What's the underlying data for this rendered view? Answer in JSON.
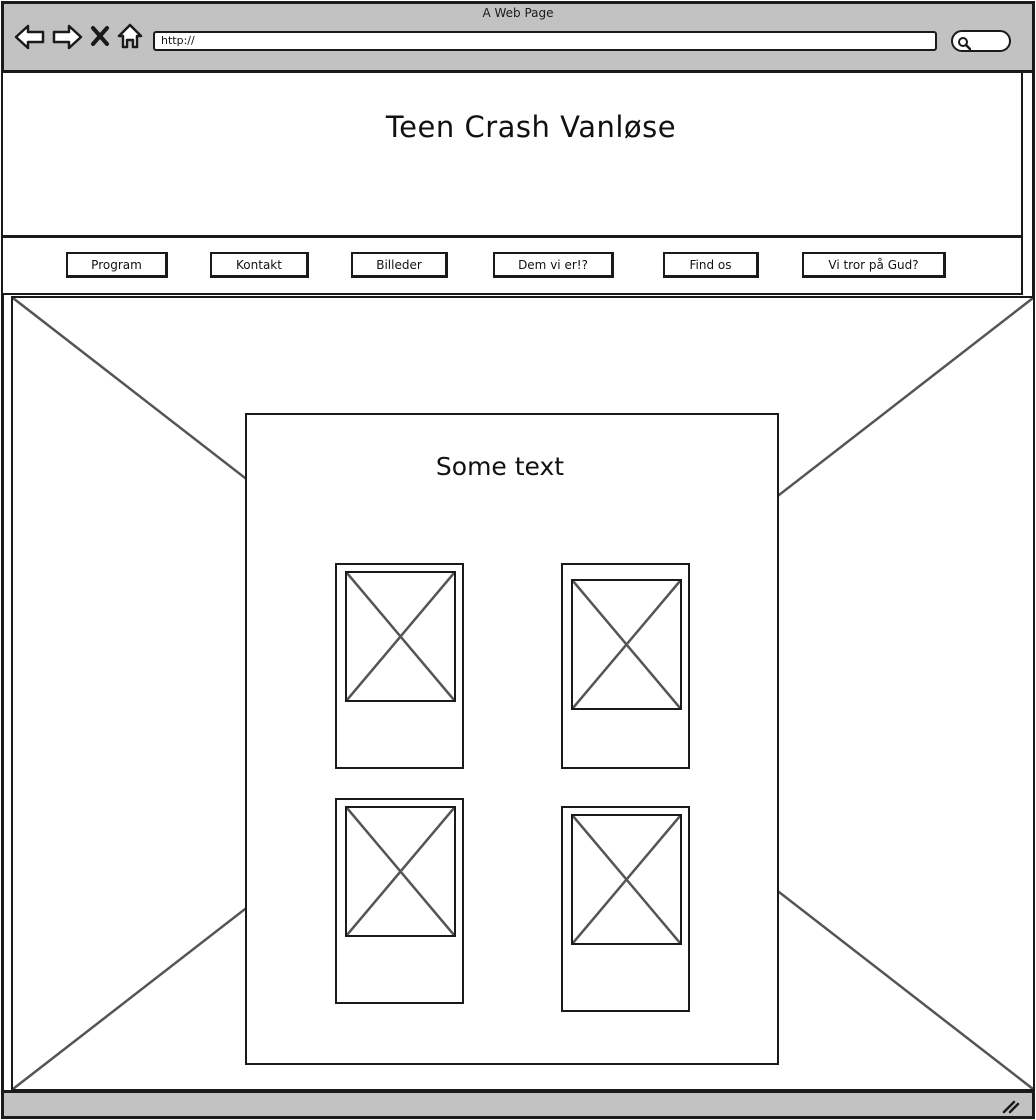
{
  "browser": {
    "window_title": "A Web Page",
    "url": "http://",
    "icons": [
      "back-icon",
      "forward-icon",
      "close-icon",
      "home-icon",
      "search-icon"
    ]
  },
  "header": {
    "title": "Teen Crash Vanløse"
  },
  "nav": {
    "items": [
      {
        "label": "Program"
      },
      {
        "label": "Kontakt"
      },
      {
        "label": "Billeder"
      },
      {
        "label": "Dem vi er!?"
      },
      {
        "label": "Find os"
      },
      {
        "label": "Vi tror på Gud?"
      }
    ]
  },
  "main": {
    "heading": "Some text",
    "cards": [
      {
        "image": "image-placeholder"
      },
      {
        "image": "image-placeholder"
      },
      {
        "image": "image-placeholder"
      },
      {
        "image": "image-placeholder"
      }
    ]
  },
  "colors": {
    "chrome": "#c2c2c2",
    "stroke": "#1a1a1a",
    "placeholder_cross": "#555555"
  }
}
